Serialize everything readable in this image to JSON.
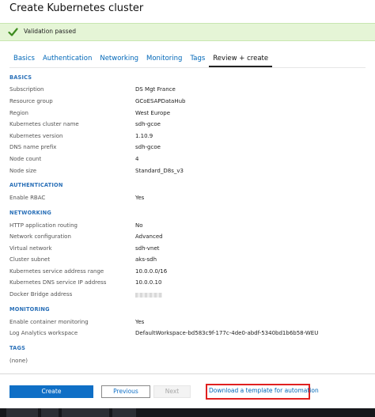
{
  "page_title": "Create Kubernetes cluster",
  "validation": {
    "text": "Validation passed",
    "color": "#e5f5d6",
    "icon": "checkmark-icon"
  },
  "tabs": [
    {
      "label": "Basics",
      "active": false
    },
    {
      "label": "Authentication",
      "active": false
    },
    {
      "label": "Networking",
      "active": false
    },
    {
      "label": "Monitoring",
      "active": false
    },
    {
      "label": "Tags",
      "active": false
    },
    {
      "label": "Review + create",
      "active": true
    }
  ],
  "sections": {
    "basics": {
      "heading": "BASICS",
      "rows": [
        {
          "label": "Subscription",
          "value": "DS Mgt France"
        },
        {
          "label": "Resource group",
          "value": "GCoESAPDataHub"
        },
        {
          "label": "Region",
          "value": "West Europe"
        },
        {
          "label": "Kubernetes cluster name",
          "value": "sdh-gcoe"
        },
        {
          "label": "Kubernetes version",
          "value": "1.10.9"
        },
        {
          "label": "DNS name prefix",
          "value": "sdh-gcoe"
        },
        {
          "label": "Node count",
          "value": "4"
        },
        {
          "label": "Node size",
          "value": "Standard_D8s_v3"
        }
      ]
    },
    "authentication": {
      "heading": "AUTHENTICATION",
      "rows": [
        {
          "label": "Enable RBAC",
          "value": "Yes"
        }
      ]
    },
    "networking": {
      "heading": "NETWORKING",
      "rows": [
        {
          "label": "HTTP application routing",
          "value": "No"
        },
        {
          "label": "Network configuration",
          "value": "Advanced"
        },
        {
          "label": "Virtual network",
          "value": "sdh-vnet"
        },
        {
          "label": "Cluster subnet",
          "value": "aks-sdh"
        },
        {
          "label": "Kubernetes service address range",
          "value": "10.0.0.0/16"
        },
        {
          "label": "Kubernetes DNS service IP address",
          "value": "10.0.0.10"
        },
        {
          "label": "Docker Bridge address",
          "value": ""
        }
      ]
    },
    "monitoring": {
      "heading": "MONITORING",
      "rows": [
        {
          "label": "Enable container monitoring",
          "value": "Yes"
        },
        {
          "label": "Log Analytics workspace",
          "value": "DefaultWorkspace-bd583c9f-177c-4de0-abdf-5340bd1b6b58-WEU"
        }
      ]
    },
    "tags": {
      "heading": "TAGS",
      "empty_text": "(none)"
    }
  },
  "footer": {
    "create_label": "Create",
    "previous_label": "Previous",
    "next_label": "Next",
    "download_label": "Download a template for automation",
    "accent": "#0f6fc6",
    "highlight": "#e02020"
  }
}
